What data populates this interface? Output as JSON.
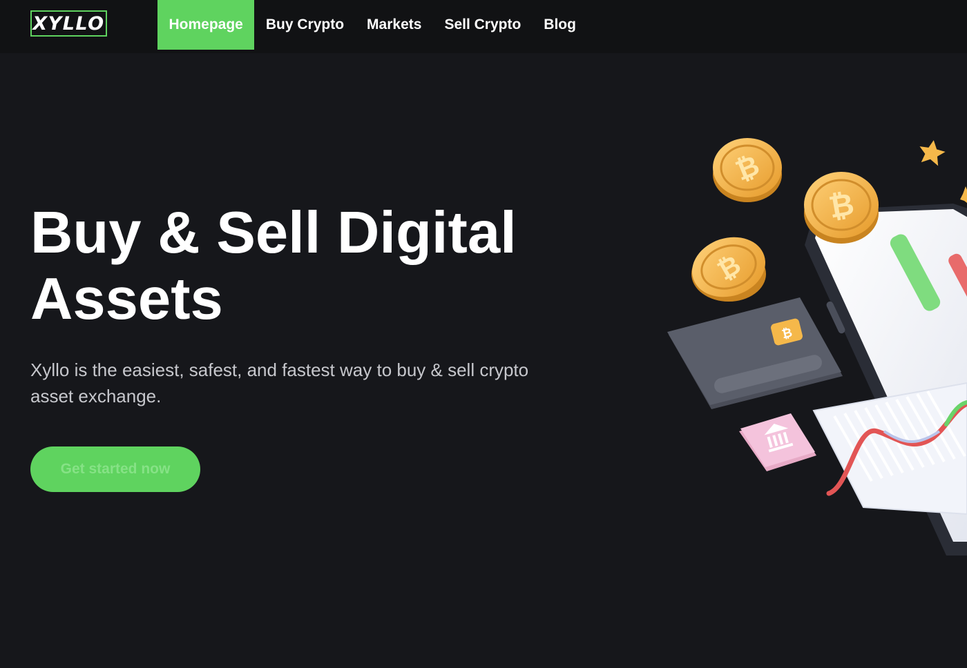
{
  "brand": {
    "logo_text": "XYLLO",
    "accent_color": "#5fd35f"
  },
  "nav": {
    "items": [
      {
        "label": "Homepage",
        "active": true
      },
      {
        "label": "Buy Crypto",
        "active": false
      },
      {
        "label": "Markets",
        "active": false
      },
      {
        "label": "Sell Crypto",
        "active": false
      },
      {
        "label": "Blog",
        "active": false
      }
    ]
  },
  "hero": {
    "title": "Buy & Sell Digital Assets",
    "subtitle": "Xyllo is the easiest, safest, and fastest way to buy & sell crypto asset exchange.",
    "cta_label": "Get started now"
  },
  "illustration": {
    "coin_symbol": "₿",
    "icons": [
      "bitcoin-coin-icon",
      "credit-card-icon",
      "bank-icon",
      "star-icon",
      "smartphone-icon",
      "candlestick-icon",
      "line-chart-icon"
    ]
  }
}
